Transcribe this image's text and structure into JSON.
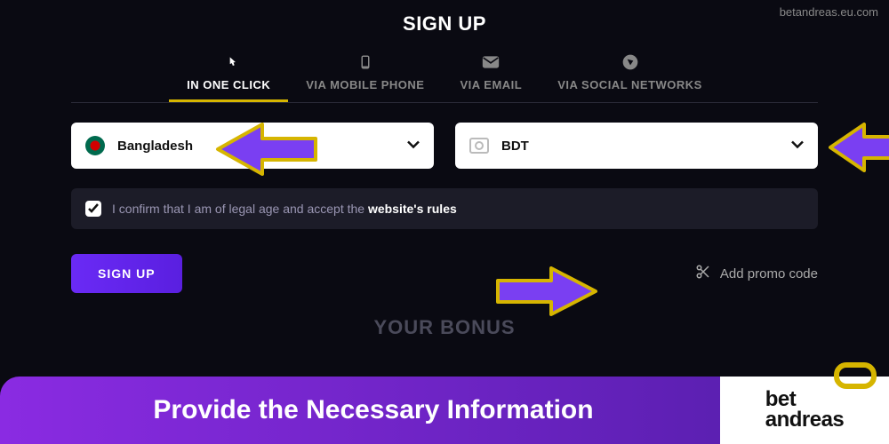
{
  "watermark": "betandreas.eu.com",
  "header": {
    "title": "SIGN UP"
  },
  "tabs": [
    {
      "label": "IN ONE CLICK",
      "active": true
    },
    {
      "label": "VIA MOBILE PHONE",
      "active": false
    },
    {
      "label": "VIA EMAIL",
      "active": false
    },
    {
      "label": "VIA SOCIAL NETWORKS",
      "active": false
    }
  ],
  "form": {
    "country": {
      "selected": "Bangladesh"
    },
    "currency": {
      "selected": "BDT"
    },
    "confirm": {
      "checked": true,
      "text_prefix": "I confirm that I am of legal age and accept the ",
      "link_text": "website's rules"
    },
    "submit_label": "SIGN UP",
    "promo_label": "Add promo code"
  },
  "bonus": {
    "title": "YOUR BONUS"
  },
  "banner": {
    "caption": "Provide the Necessary Information",
    "logo": {
      "line1": "bet",
      "line2": "andreas"
    }
  },
  "colors": {
    "accent_yellow": "#d6b500",
    "accent_purple": "#6a2af5"
  }
}
